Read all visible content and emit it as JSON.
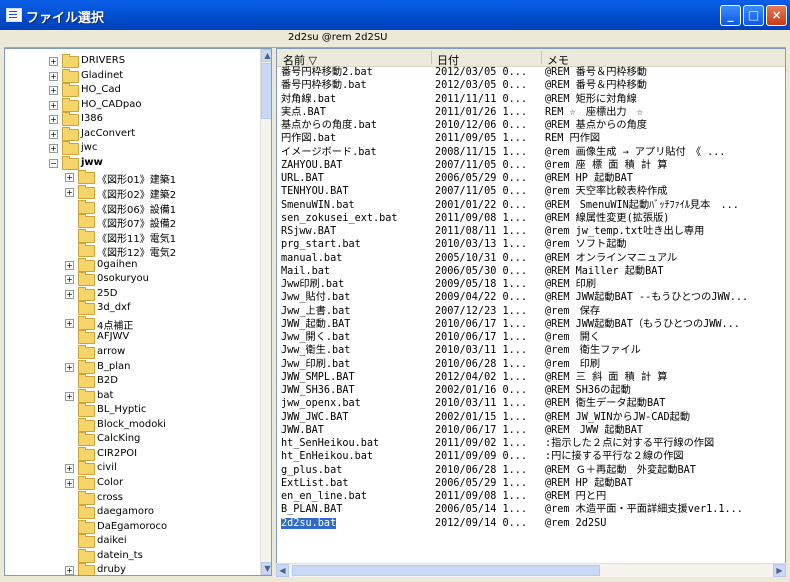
{
  "window": {
    "title": "ファイル選択"
  },
  "titlebar_buttons": {
    "minimize": "_",
    "maximize": "□",
    "close": "×"
  },
  "pathbar": {
    "text": "2d2su  @rem 2d2SU"
  },
  "tree": {
    "items": [
      {
        "label": "DRIVERS",
        "expander": "+",
        "level": 0
      },
      {
        "label": "Gladinet",
        "expander": "+",
        "level": 0
      },
      {
        "label": "HO_Cad",
        "expander": "+",
        "level": 0
      },
      {
        "label": "HO_CADpao",
        "expander": "+",
        "level": 0
      },
      {
        "label": "I386",
        "expander": "+",
        "level": 0
      },
      {
        "label": "JacConvert",
        "expander": "+",
        "level": 0
      },
      {
        "label": "jwc",
        "expander": "+",
        "level": 0
      },
      {
        "label": "jww",
        "expander": "−",
        "level": 0,
        "bold": true
      },
      {
        "label": "《図形01》建築1",
        "expander": "+",
        "level": 1
      },
      {
        "label": "《図形02》建築2",
        "expander": "+",
        "level": 1
      },
      {
        "label": "《図形06》設備1",
        "expander": "",
        "level": 1
      },
      {
        "label": "《図形07》設備2",
        "expander": "",
        "level": 1
      },
      {
        "label": "《図形11》電気1",
        "expander": "",
        "level": 1
      },
      {
        "label": "《図形12》電気2",
        "expander": "",
        "level": 1
      },
      {
        "label": "0gaihen",
        "expander": "+",
        "level": 1
      },
      {
        "label": "0sokuryou",
        "expander": "+",
        "level": 1
      },
      {
        "label": "25D",
        "expander": "+",
        "level": 1
      },
      {
        "label": "3d_dxf",
        "expander": "",
        "level": 1
      },
      {
        "label": "4点補正",
        "expander": "+",
        "level": 1
      },
      {
        "label": "AFJWV",
        "expander": "",
        "level": 1
      },
      {
        "label": "arrow",
        "expander": "",
        "level": 1
      },
      {
        "label": "B_plan",
        "expander": "+",
        "level": 1
      },
      {
        "label": "B2D",
        "expander": "",
        "level": 1
      },
      {
        "label": "bat",
        "expander": "+",
        "level": 1
      },
      {
        "label": "BL_Hyptic",
        "expander": "",
        "level": 1
      },
      {
        "label": "Block_modoki",
        "expander": "",
        "level": 1
      },
      {
        "label": "CalcKing",
        "expander": "",
        "level": 1
      },
      {
        "label": "CIR2POI",
        "expander": "",
        "level": 1
      },
      {
        "label": "civil",
        "expander": "+",
        "level": 1
      },
      {
        "label": "Color",
        "expander": "+",
        "level": 1
      },
      {
        "label": "cross",
        "expander": "",
        "level": 1
      },
      {
        "label": "daegamoro",
        "expander": "",
        "level": 1
      },
      {
        "label": "DaEgamoroco",
        "expander": "",
        "level": 1
      },
      {
        "label": "daikei",
        "expander": "",
        "level": 1
      },
      {
        "label": "datein_ts",
        "expander": "",
        "level": 1
      },
      {
        "label": "druby",
        "expander": "+",
        "level": 1
      }
    ]
  },
  "list": {
    "headers": {
      "name": "名前 ▽",
      "date": "日付",
      "memo": "メモ"
    },
    "rows": [
      {
        "name": "番号円枠移動2.bat",
        "date": "2012/03/05 0...",
        "memo": "@REM 番号＆円枠移動"
      },
      {
        "name": "番号円枠移動.bat",
        "date": "2012/03/05 0...",
        "memo": "@REM 番号＆円枠移動"
      },
      {
        "name": "対角線.bat",
        "date": "2011/11/11 0...",
        "memo": "@REM 矩形に対角線"
      },
      {
        "name": "実点.BAT",
        "date": "2011/01/26 1...",
        "memo": "REM ☆　座標出力　☆"
      },
      {
        "name": "基点からの角度.bat",
        "date": "2010/12/06 0...",
        "memo": "@REM 基点からの角度"
      },
      {
        "name": "円作図.bat",
        "date": "2011/09/05 1...",
        "memo": "REM 円作図"
      },
      {
        "name": "イメージボード.bat",
        "date": "2008/11/15 1...",
        "memo": "@rem 画像生成 → アプリ貼付　《 ..."
      },
      {
        "name": "ZAHYOU.BAT",
        "date": "2007/11/05 0...",
        "memo": "@rem 座 標 面 積 計 算"
      },
      {
        "name": "URL.BAT",
        "date": "2006/05/29 0...",
        "memo": "@REM HP 起動BAT"
      },
      {
        "name": "TENHYOU.BAT",
        "date": "2007/11/05 0...",
        "memo": "@rem 天空率比較表枠作成"
      },
      {
        "name": "SmenuWIN.bat",
        "date": "2001/01/22 0...",
        "memo": "@REM　SmenuWIN起動ﾊﾞｯﾁﾌｧｲﾙ見本　..."
      },
      {
        "name": "sen_zokusei_ext.bat",
        "date": "2011/09/08 1...",
        "memo": "@REM 線属性変更(拡張版)"
      },
      {
        "name": "RSjww.BAT",
        "date": "2011/08/11 1...",
        "memo": "@rem jw_temp.txt吐き出し専用"
      },
      {
        "name": "prg_start.bat",
        "date": "2010/03/13 1...",
        "memo": "@rem ソフト起動"
      },
      {
        "name": "manual.bat",
        "date": "2005/10/31 0...",
        "memo": "@REM オンラインマニュアル"
      },
      {
        "name": "Mail.bat",
        "date": "2006/05/30 0...",
        "memo": "@REM Mailler 起動BAT"
      },
      {
        "name": "Jww印刷.bat",
        "date": "2009/05/18 1...",
        "memo": "@REM 印刷"
      },
      {
        "name": "Jww_貼付.bat",
        "date": "2009/04/22 0...",
        "memo": "@REM JWW起動BAT --もうひとつのJWW..."
      },
      {
        "name": "Jww_上書.bat",
        "date": "2007/12/23 1...",
        "memo": "@rem　保存"
      },
      {
        "name": "JWW_起動.BAT",
        "date": "2010/06/17 1...",
        "memo": "@REM JWW起動BAT（もうひとつのJWW..."
      },
      {
        "name": "Jww_開く.bat",
        "date": "2010/06/17 1...",
        "memo": "@rem　開く"
      },
      {
        "name": "Jww_衛生.bat",
        "date": "2010/03/11 1...",
        "memo": "@rem　衛生ファイル"
      },
      {
        "name": "Jww_印刷.bat",
        "date": "2010/06/28 1...",
        "memo": "@rem　印刷"
      },
      {
        "name": "JWW_SMPL.BAT",
        "date": "2012/04/02 1...",
        "memo": "@REM 三 斜 面 積 計 算"
      },
      {
        "name": "JWW_SH36.BAT",
        "date": "2002/01/16 0...",
        "memo": "@REM SH36の起動"
      },
      {
        "name": "jww_openx.bat",
        "date": "2010/03/11 1...",
        "memo": "@REM 衛生データ起動BAT"
      },
      {
        "name": "JWW_JWC.BAT",
        "date": "2002/01/15 1...",
        "memo": "@REM JW_WINからJW-CAD起動"
      },
      {
        "name": "JWW.BAT",
        "date": "2010/06/17 1...",
        "memo": "@REM　JWW 起動BAT"
      },
      {
        "name": "ht_SenHeikou.bat",
        "date": "2011/09/02 1...",
        "memo": ":指示した２点に対する平行線の作図"
      },
      {
        "name": "ht_EnHeikou.bat",
        "date": "2011/09/09 0...",
        "memo": ":円に接する平行な２線の作図"
      },
      {
        "name": "g_plus.bat",
        "date": "2010/06/28 1...",
        "memo": "@REM Ｇ＋再起動　外変起動BAT"
      },
      {
        "name": "ExtList.bat",
        "date": "2006/05/29 1...",
        "memo": "@REM HP 起動BAT"
      },
      {
        "name": "en_en_line.bat",
        "date": "2011/09/08 1...",
        "memo": "@REM 円と円"
      },
      {
        "name": "B_PLAN.BAT",
        "date": "2006/05/14 1...",
        "memo": "@rem 木造平面・平面詳細支援ver1.1..."
      },
      {
        "name": "2d2su.bat",
        "date": "2012/09/14 0...",
        "memo": "@rem 2d2SU",
        "selected": true
      }
    ]
  },
  "hscroll": {
    "left_arrow": "◀",
    "right_arrow": "▶"
  },
  "vscroll": {
    "up_arrow": "▲",
    "down_arrow": "▼"
  },
  "colors": {
    "titlebar": "#0454d6",
    "selection": "#316ac5",
    "folder": "#f5d56a"
  }
}
